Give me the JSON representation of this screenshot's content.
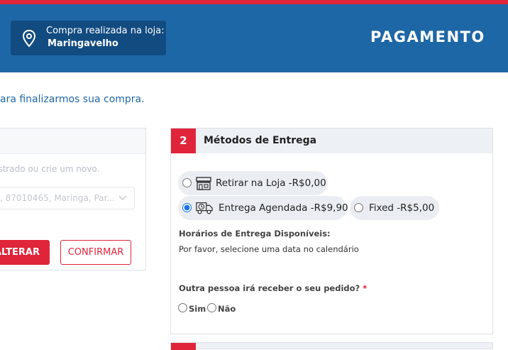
{
  "header": {
    "store_label": "Compra realizada na loja:",
    "store_name": "Maringavelho",
    "page_title": "PAGAMENTO"
  },
  "intro_text": "ara finalizarmos sua compra.",
  "address_card": {
    "hint": "astrado ou crie um novo.",
    "select_value": ", 87010465, Maringa, Par...",
    "alter_button": "ALTERAR",
    "confirm_button": "CONFIRMAR"
  },
  "delivery": {
    "step_number": "2",
    "title": "Métodos de Entrega",
    "options": [
      {
        "icon": "store-icon",
        "label": "Retirar na Loja",
        "price": " -R$0,00",
        "selected": false
      },
      {
        "icon": "truck-clock-icon",
        "label": "Entrega Agendada",
        "price": " -R$9,90",
        "selected": true
      },
      {
        "icon": "",
        "label": "Fixed",
        "price": " -R$5,00",
        "selected": false
      }
    ],
    "schedule_title": "Horários de Entrega Disponíveis:",
    "schedule_message": "Por favor, selecione uma data no calendário",
    "other_person_question": "Outra pessoa irá receber o seu pedido?",
    "required_mark": "*",
    "yes_label": "Sim",
    "no_label": "Não"
  },
  "colors": {
    "brand_blue": "#1e67a6",
    "dark_blue": "#124b80",
    "accent_red": "#e0253a"
  }
}
